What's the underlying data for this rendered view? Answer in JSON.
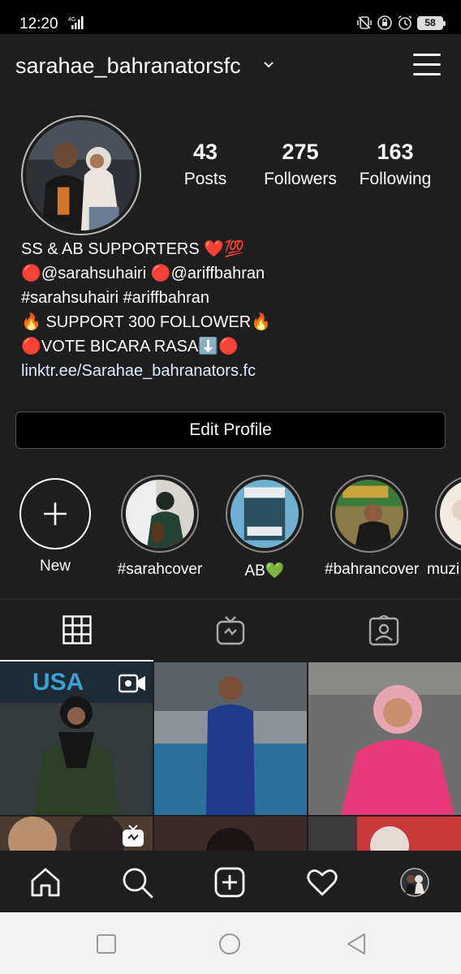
{
  "status_bar": {
    "time": "12:20",
    "network": "4G",
    "battery": "58",
    "icons": [
      "vibrate-icon",
      "rotation-lock-icon",
      "alarm-icon",
      "battery-icon"
    ]
  },
  "header": {
    "username": "sarahae_bahranatorsfc",
    "icons": [
      "chevron-down-icon",
      "menu-icon"
    ]
  },
  "profile": {
    "stats": [
      {
        "value": "43",
        "label": "Posts"
      },
      {
        "value": "275",
        "label": "Followers"
      },
      {
        "value": "163",
        "label": "Following"
      }
    ],
    "bio": [
      "SS & AB SUPPORTERS ❤️💯",
      "🔴@sarahsuhairi 🔴@ariffbahran",
      " #sarahsuhairi #ariffbahran",
      "🔥 SUPPORT 300 FOLLOWER🔥",
      "🔴VOTE BICARA RASA⬇️🔴"
    ],
    "link": "linktr.ee/Sarahae_bahranators.fc",
    "edit_button": "Edit Profile"
  },
  "highlights": [
    {
      "label": "New"
    },
    {
      "label": "#sarahcover"
    },
    {
      "label": "AB💚"
    },
    {
      "label": "#bahrancover"
    },
    {
      "label": "muzi"
    }
  ],
  "tabs": [
    "grid-icon",
    "igtv-icon",
    "tagged-icon"
  ],
  "bottom_nav": [
    "home-icon",
    "search-icon",
    "add-post-icon",
    "heart-icon",
    "profile-avatar"
  ],
  "system_nav": [
    "recents-button",
    "home-button",
    "back-button"
  ],
  "colors": {
    "background": "#1e1e1e",
    "status_bar": "#000000",
    "link": "#e0ecff",
    "heart": "#e0245e"
  }
}
